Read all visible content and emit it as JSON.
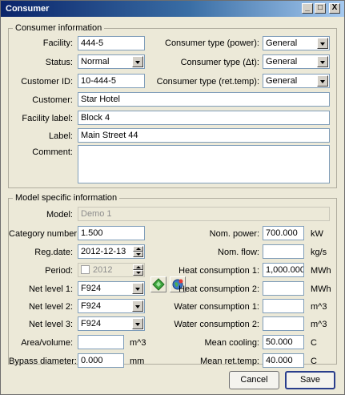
{
  "window": {
    "title": "Consumer",
    "minimize": "_",
    "maximize": "□",
    "close": "X"
  },
  "consumer_info": {
    "legend": "Consumer information",
    "facility": {
      "label": "Facility:",
      "value": "444-5"
    },
    "status": {
      "label": "Status:",
      "value": "Normal"
    },
    "customer_id": {
      "label": "Customer ID:",
      "value": "10-444-5"
    },
    "customer": {
      "label": "Customer:",
      "value": "Star Hotel"
    },
    "facility_label": {
      "label": "Facility label:",
      "value": "Block 4"
    },
    "label": {
      "label": "Label:",
      "value": "Main Street 44"
    },
    "comment": {
      "label": "Comment:",
      "value": ""
    },
    "type_power": {
      "label": "Consumer type (power):",
      "value": "General"
    },
    "type_dt": {
      "label": "Consumer type (Δt):",
      "value": "General"
    },
    "type_ret": {
      "label": "Consumer type (ret.temp):",
      "value": "General"
    }
  },
  "model_info": {
    "legend": "Model specific information",
    "model": {
      "label": "Model:",
      "value": "Demo 1"
    },
    "category_number": {
      "label": "Category number:",
      "value": "1.500"
    },
    "reg_date": {
      "label": "Reg.date:",
      "value": "2012-12-13"
    },
    "period": {
      "label": "Period:",
      "value": "2012"
    },
    "net_level_1": {
      "label": "Net level 1:",
      "value": "F924"
    },
    "net_level_2": {
      "label": "Net level 2:",
      "value": "F924"
    },
    "net_level_3": {
      "label": "Net level 3:",
      "value": "F924"
    },
    "area_volume": {
      "label": "Area/volume:",
      "value": "",
      "unit": "m^3"
    },
    "bypass_diameter": {
      "label": "Bypass diameter:",
      "value": "0.000",
      "unit": "mm"
    },
    "nom_power": {
      "label": "Nom. power:",
      "value": "700.000",
      "unit": "kW"
    },
    "nom_flow": {
      "label": "Nom. flow:",
      "value": "",
      "unit": "kg/s"
    },
    "heat_consumption_1": {
      "label": "Heat consumption 1:",
      "value": "1,000.000",
      "unit": "MWh"
    },
    "heat_consumption_2": {
      "label": "Heat consumption 2:",
      "value": "",
      "unit": "MWh"
    },
    "water_consumption_1": {
      "label": "Water consumption 1:",
      "value": "",
      "unit": "m^3"
    },
    "water_consumption_2": {
      "label": "Water consumption 2:",
      "value": "",
      "unit": "m^3"
    },
    "mean_cooling": {
      "label": "Mean cooling:",
      "value": "50.000",
      "unit": "C"
    },
    "mean_ret_temp": {
      "label": "Mean ret.temp:",
      "value": "40.000",
      "unit": "C"
    }
  },
  "buttons": {
    "cancel": "Cancel",
    "save": "Save"
  },
  "icons": {
    "green_button": "green-diamond-icon",
    "globe_button": "globe-icon"
  }
}
